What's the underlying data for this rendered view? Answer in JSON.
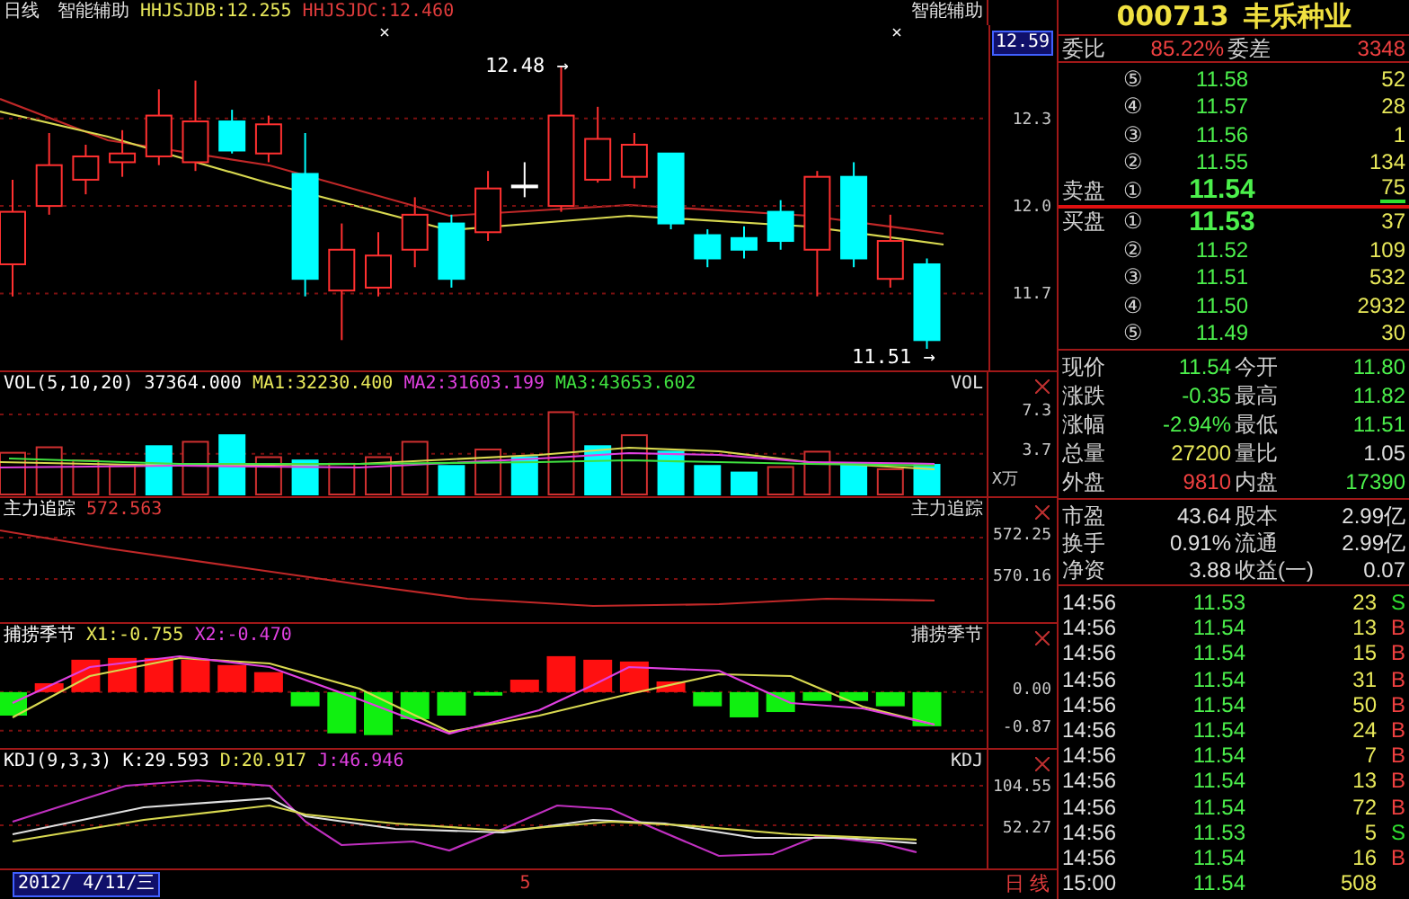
{
  "main_chart": {
    "period": "日线",
    "indicator": "智能辅助",
    "legend": [
      {
        "text": "HHJSJDB:12.255",
        "color": "#e8e85a"
      },
      {
        "text": "HHJSJDC:12.460",
        "color": "#e03c3c"
      }
    ],
    "right_label": "智能辅助",
    "high_label": "12.48 →",
    "low_label": "11.51 →",
    "current_price": "12.59",
    "chart_data": {
      "type": "candlestick",
      "grid": true,
      "ylim": [
        11.43,
        12.62
      ],
      "yticks": [
        {
          "value": 12.3,
          "label": "12.3"
        },
        {
          "value": 12.0,
          "label": "12.0"
        },
        {
          "value": 11.7,
          "label": "11.7"
        }
      ],
      "ohlc": [
        [
          11.8,
          12.09,
          11.69,
          11.98
        ],
        [
          12.0,
          12.25,
          11.97,
          12.14
        ],
        [
          12.09,
          12.21,
          12.04,
          12.17
        ],
        [
          12.15,
          12.26,
          12.1,
          12.18
        ],
        [
          12.17,
          12.4,
          12.14,
          12.31
        ],
        [
          12.15,
          12.43,
          12.12,
          12.29
        ],
        [
          12.29,
          12.33,
          12.18,
          12.19
        ],
        [
          12.18,
          12.31,
          12.15,
          12.28
        ],
        [
          12.11,
          12.25,
          11.69,
          11.75
        ],
        [
          11.71,
          11.94,
          11.54,
          11.85
        ],
        [
          11.72,
          11.91,
          11.69,
          11.83
        ],
        [
          11.85,
          12.03,
          11.79,
          11.97
        ],
        [
          11.94,
          11.97,
          11.72,
          11.75
        ],
        [
          11.91,
          12.12,
          11.88,
          12.06
        ],
        [
          12.07,
          12.15,
          12.03,
          12.07
        ],
        [
          12.0,
          12.48,
          11.98,
          12.31
        ],
        [
          12.09,
          12.34,
          12.08,
          12.23
        ],
        [
          12.1,
          12.25,
          12.06,
          12.21
        ],
        [
          12.18,
          12.18,
          11.92,
          11.94
        ],
        [
          11.9,
          11.92,
          11.79,
          11.82
        ],
        [
          11.89,
          11.93,
          11.82,
          11.85
        ],
        [
          11.98,
          12.02,
          11.85,
          11.88
        ],
        [
          11.85,
          12.12,
          11.69,
          12.1
        ],
        [
          12.1,
          12.15,
          11.79,
          11.82
        ],
        [
          11.75,
          11.97,
          11.72,
          11.88
        ],
        [
          11.8,
          11.82,
          11.51,
          11.54
        ]
      ]
    }
  },
  "volume_panel": {
    "legend": [
      {
        "text": "VOL(5,10,20)",
        "color": "#ffffff"
      },
      {
        "text": "37364.000",
        "color": "#ffffff"
      },
      {
        "text": "MA1:32230.400",
        "color": "#e8e85a"
      },
      {
        "text": "MA2:31603.199",
        "color": "#e040e0"
      },
      {
        "text": "MA3:43653.602",
        "color": "#40e040"
      }
    ],
    "right_label": "VOL",
    "unit": "X万",
    "ticks": [
      "7.3",
      "3.7"
    ]
  },
  "main_force_panel": {
    "legend": [
      {
        "text": "主力追踪",
        "color": "#ffffff"
      },
      {
        "text": "572.563",
        "color": "#e03c3c"
      }
    ],
    "right_label": "主力追踪",
    "ticks": [
      "572.25",
      "570.16"
    ]
  },
  "season_panel": {
    "legend": [
      {
        "text": "捕捞季节",
        "color": "#ffffff"
      },
      {
        "text": "X1:-0.755",
        "color": "#e8e85a"
      },
      {
        "text": "X2:-0.470",
        "color": "#e040e0"
      }
    ],
    "right_label": "捕捞季节",
    "ticks": [
      "0.00",
      "-0.87"
    ]
  },
  "kdj_panel": {
    "legend": [
      {
        "text": "KDJ(9,3,3)",
        "color": "#ffffff"
      },
      {
        "text": "K:29.593",
        "color": "#ffffff"
      },
      {
        "text": "D:20.917",
        "color": "#e8e85a"
      },
      {
        "text": "J:46.946",
        "color": "#e040e0"
      }
    ],
    "right_label": "KDJ",
    "ticks": [
      "104.55",
      "52.27"
    ]
  },
  "bottom_bar": {
    "date": "2012/ 4/11/三",
    "cursor": "5",
    "period": "日 线"
  },
  "quote": {
    "code": "000713",
    "name": "丰乐种业",
    "ratio": {
      "label": "委比",
      "value": "85.22%",
      "diff_label": "委差",
      "diff": "3348"
    },
    "asks": [
      {
        "num": "⑤",
        "price": "11.58",
        "volume": "52"
      },
      {
        "num": "④",
        "price": "11.57",
        "volume": "28"
      },
      {
        "num": "③",
        "price": "11.56",
        "volume": "1"
      },
      {
        "num": "②",
        "price": "11.55",
        "volume": "134"
      },
      {
        "label": "卖盘",
        "num": "①",
        "price": "11.54",
        "volume": "75"
      }
    ],
    "bids": [
      {
        "label": "买盘",
        "num": "①",
        "price": "11.53",
        "volume": "37"
      },
      {
        "num": "②",
        "price": "11.52",
        "volume": "109"
      },
      {
        "num": "③",
        "price": "11.51",
        "volume": "532"
      },
      {
        "num": "④",
        "price": "11.50",
        "volume": "2932"
      },
      {
        "num": "⑤",
        "price": "11.49",
        "volume": "30"
      }
    ],
    "stats": [
      {
        "left": {
          "label": "现价",
          "value": "11.54",
          "color": "#4cf04c"
        },
        "right": {
          "label": "今开",
          "value": "11.80",
          "color": "#4cf04c"
        }
      },
      {
        "left": {
          "label": "涨跌",
          "value": "-0.35",
          "color": "#4cf04c"
        },
        "right": {
          "label": "最高",
          "value": "11.82",
          "color": "#4cf04c"
        }
      },
      {
        "left": {
          "label": "涨幅",
          "value": "-2.94%",
          "color": "#4cf04c"
        },
        "right": {
          "label": "最低",
          "value": "11.51",
          "color": "#4cf04c"
        }
      },
      {
        "left": {
          "label": "总量",
          "value": "27200",
          "color": "#e8e85a"
        },
        "right": {
          "label": "量比",
          "value": "1.05",
          "color": "#e0e0e0"
        }
      },
      {
        "left": {
          "label": "外盘",
          "value": "9810",
          "color": "#f04040"
        },
        "right": {
          "label": "内盘",
          "value": "17390",
          "color": "#4cf04c"
        }
      }
    ],
    "fundamentals": [
      {
        "label": "市盈",
        "value": "43.64",
        "label2": "股本",
        "value2": "2.99亿"
      },
      {
        "label": "换手",
        "value": "0.91%",
        "label2": "流通",
        "value2": "2.99亿"
      },
      {
        "label": "净资",
        "value": "3.88",
        "label2": "收益(一)",
        "value2": "0.07"
      }
    ],
    "trades": [
      {
        "time": "14:56",
        "price": "11.53",
        "volume": "23",
        "side": "S",
        "kind": "sell"
      },
      {
        "time": "14:56",
        "price": "11.54",
        "volume": "13",
        "side": "B",
        "kind": "buy"
      },
      {
        "time": "14:56",
        "price": "11.54",
        "volume": "15",
        "side": "B",
        "kind": "buy"
      },
      {
        "time": "14:56",
        "price": "11.54",
        "volume": "31",
        "side": "B",
        "kind": "buy"
      },
      {
        "time": "14:56",
        "price": "11.54",
        "volume": "50",
        "side": "B",
        "kind": "buy"
      },
      {
        "time": "14:56",
        "price": "11.54",
        "volume": "24",
        "side": "B",
        "kind": "buy"
      },
      {
        "time": "14:56",
        "price": "11.54",
        "volume": "7",
        "side": "B",
        "kind": "buy"
      },
      {
        "time": "14:56",
        "price": "11.54",
        "volume": "13",
        "side": "B",
        "kind": "buy"
      },
      {
        "time": "14:56",
        "price": "11.54",
        "volume": "72",
        "side": "B",
        "kind": "buy"
      },
      {
        "time": "14:56",
        "price": "11.53",
        "volume": "5",
        "side": "S",
        "kind": "sell"
      },
      {
        "time": "14:56",
        "price": "11.54",
        "volume": "16",
        "side": "B",
        "kind": "buy"
      },
      {
        "time": "15:00",
        "price": "11.54",
        "volume": "508"
      }
    ]
  }
}
